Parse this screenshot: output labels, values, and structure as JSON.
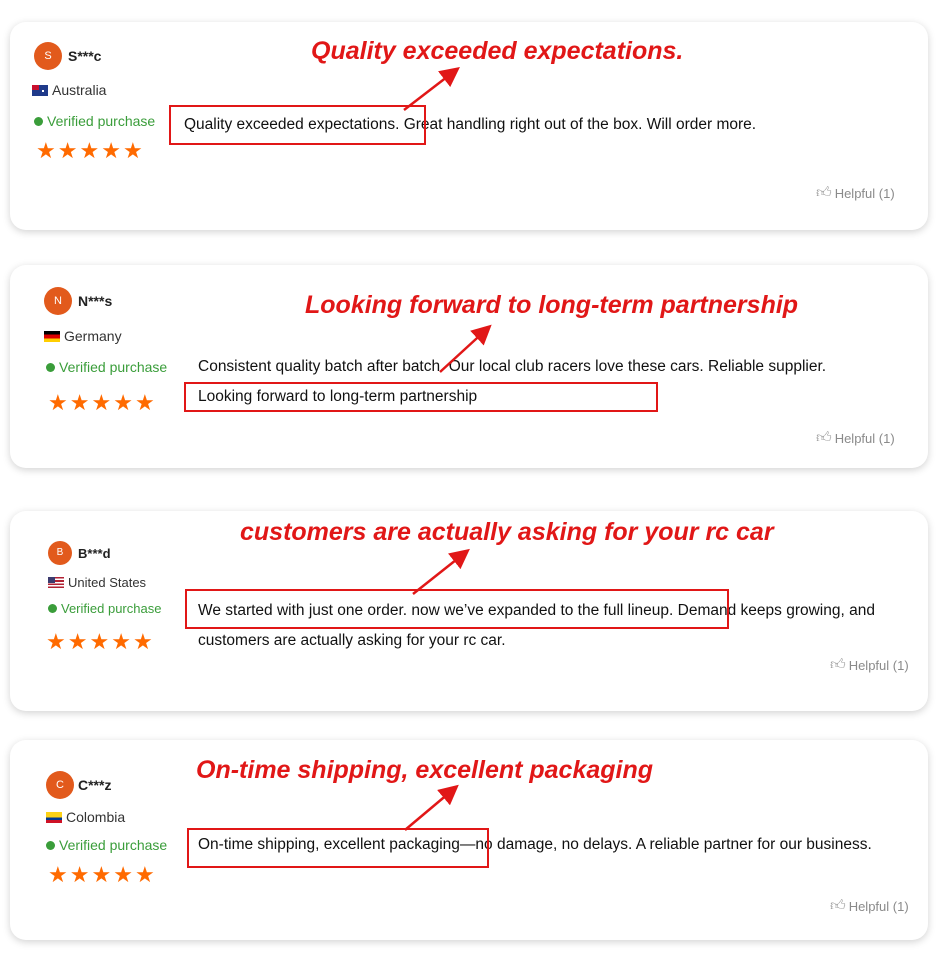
{
  "colors": {
    "accent": "#e11717",
    "star": "#ff6a00",
    "verified": "#3a9d3a",
    "avatar": "#e25a1c"
  },
  "reviews": [
    {
      "initial": "S",
      "name": "S***c",
      "country": "Australia",
      "flag": "flag-australia-icon",
      "verified": "Verified purchase",
      "stars": 5,
      "lines": [
        "Quality exceeded expectations. Great handling right out of the box. Will order more."
      ],
      "helpful": "Helpful (1)",
      "annotation": "Quality exceeded expectations."
    },
    {
      "initial": "N",
      "name": "N***s",
      "country": "Germany",
      "flag": "flag-germany-icon",
      "verified": "Verified purchase",
      "stars": 5,
      "lines": [
        "Consistent quality batch after batch. Our local club racers love these cars. Reliable supplier.",
        "Looking forward to long-term partnership"
      ],
      "helpful": "Helpful (1)",
      "annotation": "Looking forward to long-term partnership"
    },
    {
      "initial": "B",
      "name": "B***d",
      "country": "United States",
      "flag": "flag-us-icon",
      "verified": "Verified purchase",
      "stars": 5,
      "lines": [
        "We started with just one order. now we’ve expanded to the full lineup. Demand keeps growing, and",
        "customers are actually asking for your rc car."
      ],
      "helpful": "Helpful (1)",
      "annotation": "customers are actually asking for your rc car"
    },
    {
      "initial": "C",
      "name": "C***z",
      "country": "Colombia",
      "flag": "flag-colombia-icon",
      "verified": "Verified purchase",
      "stars": 5,
      "lines": [
        "On-time shipping, excellent packaging—no damage, no delays. A reliable partner for our business."
      ],
      "helpful": "Helpful (1)",
      "annotation": "On-time shipping, excellent packaging"
    }
  ]
}
